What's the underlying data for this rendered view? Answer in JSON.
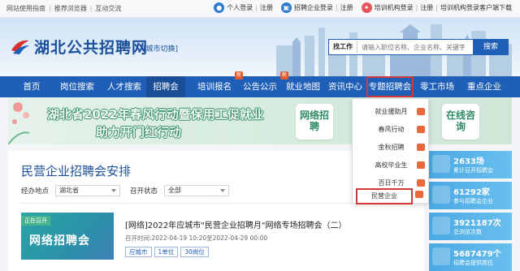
{
  "topbar": {
    "links": [
      "网站使用指南",
      "推荐浏览器",
      "互动交流"
    ],
    "personal": {
      "login": "个人登录",
      "register": "注册"
    },
    "company": {
      "login": "招聘企业登录",
      "register": "注册"
    },
    "training": {
      "login": "培训机构登录",
      "register": "注册"
    },
    "client": "培训机构登录客户端下载"
  },
  "header": {
    "logo_text": "湖北公共招聘网",
    "city_switch": "[城市切换]",
    "search_type": "找工作",
    "search_placeholder": "请输入职位名称、企业名称、关键字",
    "search_button": "搜索"
  },
  "nav": {
    "items": [
      "首页",
      "岗位搜索",
      "人才搜索",
      "招聘会",
      "培训报名",
      "公告公示",
      "就业地图",
      "资讯中心",
      "专题招聘会",
      "零工市场",
      "重点企业"
    ],
    "badges": [
      "新",
      "新"
    ]
  },
  "banner": {
    "line1": "湖北省2022年春风行动暨保用工促就业",
    "line2": "助力开门红行动",
    "tiles": [
      "网络招聘",
      "在线咨询"
    ]
  },
  "main": {
    "title": "民营企业招聘会安排",
    "filter_area_label": "经办地点",
    "filter_area_value": "湖北省",
    "filter_status_label": "召开状态",
    "filter_status_value": "全部"
  },
  "job": {
    "thumb_tag": "正在召开",
    "thumb_text": "网络招聘会",
    "title": "[网络]2022年应城市\"民营企业招聘月\"网络专场招聘会（二）",
    "time": "召开时间:2022-04-19 10:20至2022-04-29 00:00",
    "tags": [
      "应城市",
      "1单位",
      "30岗位"
    ]
  },
  "stats": [
    {
      "num": "2633场",
      "label": "累计召开招聘会"
    },
    {
      "num": "61292家",
      "label": "参与招聘会企业"
    },
    {
      "num": "3921187次",
      "label": "总浏览次数"
    },
    {
      "num": "5687479个",
      "label": "招聘会提供岗位"
    }
  ],
  "dropdown": {
    "items": [
      "就业援助月",
      "春风行动",
      "金秋招聘",
      "高校毕业生",
      "百日千万",
      "民营企业"
    ]
  },
  "colors": {
    "primary": "#1f5fb8",
    "highlight": "#d23a3a",
    "banner_green": "#2f8c66",
    "stat_blue": "#4aa8e2"
  }
}
